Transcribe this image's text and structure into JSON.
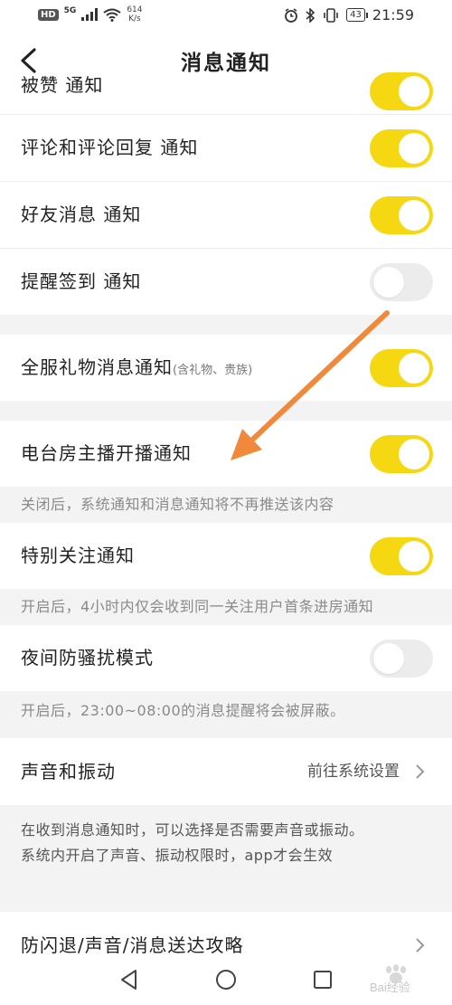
{
  "status_bar": {
    "hd": "HD",
    "network": "5G",
    "speed_value": "614",
    "speed_unit": "K/s",
    "battery": "43",
    "time": "21:59"
  },
  "header": {
    "title": "消息通知"
  },
  "settings": {
    "row0": {
      "label": "被赞 通知",
      "on": true
    },
    "row1": {
      "label": "评论和评论回复 通知",
      "on": true
    },
    "row2": {
      "label": "好友消息 通知",
      "on": true
    },
    "row3": {
      "label": "提醒签到 通知",
      "on": false
    },
    "row4": {
      "label": "全服礼物消息通知",
      "sub": "(含礼物、贵族)",
      "on": true
    },
    "row5": {
      "label": "电台房主播开播通知",
      "on": true
    },
    "row5_note": "关闭后，系统通知和消息通知将不再推送该内容",
    "row6": {
      "label": "特别关注通知",
      "on": true
    },
    "row6_note": "开启后，4小时内仅会收到同一关注用户首条进房通知",
    "row7": {
      "label": "夜间防骚扰模式",
      "on": false
    },
    "row7_note": "开启后，23:00~08:00的消息提醒将会被屏蔽。",
    "sound": {
      "label": "声音和振动",
      "value": "前往系统设置"
    },
    "sound_note_1": "在收到消息通知时，可以选择是否需要声音或振动。",
    "sound_note_2": "系统内开启了声音、振动权限时，app才会生效",
    "guide": {
      "label": "防闪退/声音/消息送达攻略"
    }
  },
  "icons": {
    "back": "back-arrow-icon",
    "chevron": "chevron-right-icon",
    "nav_back": "triangle-back-icon",
    "nav_home": "circle-home-icon",
    "nav_recent": "square-recent-icon"
  },
  "colors": {
    "toggle_on": "#f6d812",
    "toggle_off": "#ececec",
    "annotation_arrow": "#f0893a",
    "section_bg": "#f3f3f3"
  },
  "watermark": {
    "text": "Bai经验"
  }
}
